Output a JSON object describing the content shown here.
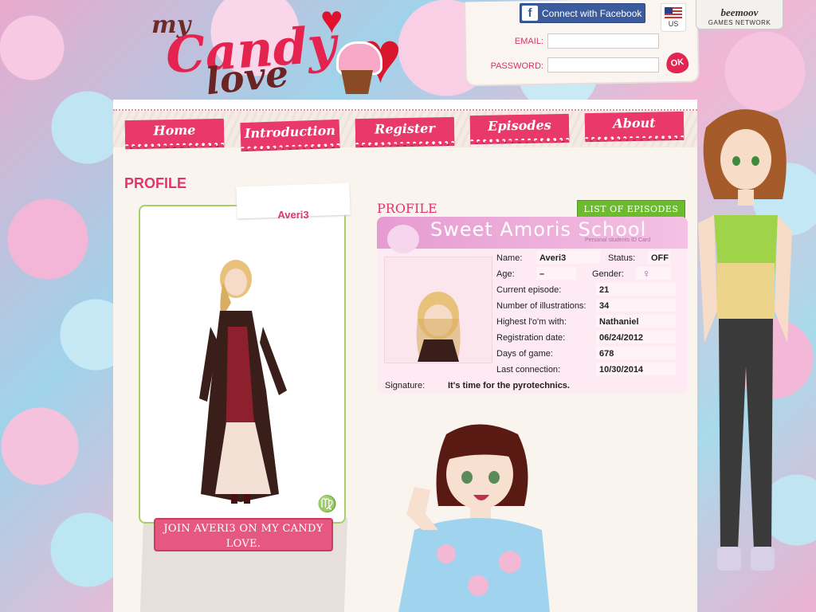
{
  "header": {
    "logo_my": "my",
    "logo_candy": "Candy",
    "logo_love": "love",
    "facebook_label": "Connect with Facebook",
    "language": "US",
    "email_label": "EMAIL:",
    "password_label": "PASSWORD:",
    "ok_label": "OK",
    "network_logo": "beemoov",
    "network_label": "GAMES NETWORK"
  },
  "nav": {
    "items": [
      {
        "label": "Home"
      },
      {
        "label": "Introduction"
      },
      {
        "label": "Register"
      },
      {
        "label": "Episodes"
      },
      {
        "label": "About"
      }
    ]
  },
  "profile": {
    "heading": "PROFILE",
    "username": "Averi3",
    "join_label": "JOIN AVERI3 ON MY CANDY LOVE.",
    "zodiac_symbol": "♍"
  },
  "idcard": {
    "heading": "PROFILE",
    "episodes_button": "LIST OF EPISODES",
    "school": "Sweet Amoris School",
    "subtitle": "Personal students ID Card",
    "fields": {
      "name_label": "Name:",
      "name": "Averi3",
      "status_label": "Status:",
      "status": "OFF",
      "age_label": "Age:",
      "age": "–",
      "gender_label": "Gender:",
      "gender": "♀",
      "episode_label": "Current episode:",
      "episode": "21",
      "illustrations_label": "Number of illustrations:",
      "illustrations": "34",
      "lovom_label": "Highest l'o'm with:",
      "lovom": "Nathaniel",
      "registration_label": "Registration date:",
      "registration": "06/24/2012",
      "days_label": "Days of game:",
      "days": "678",
      "connection_label": "Last connection:",
      "connection": "10/30/2014",
      "signature_label": "Signature:",
      "signature": "It's time for the pyrotechnics."
    }
  },
  "colors": {
    "accent": "#e3356b",
    "green": "#6cbb2e",
    "facebook": "#3b5b9c"
  }
}
